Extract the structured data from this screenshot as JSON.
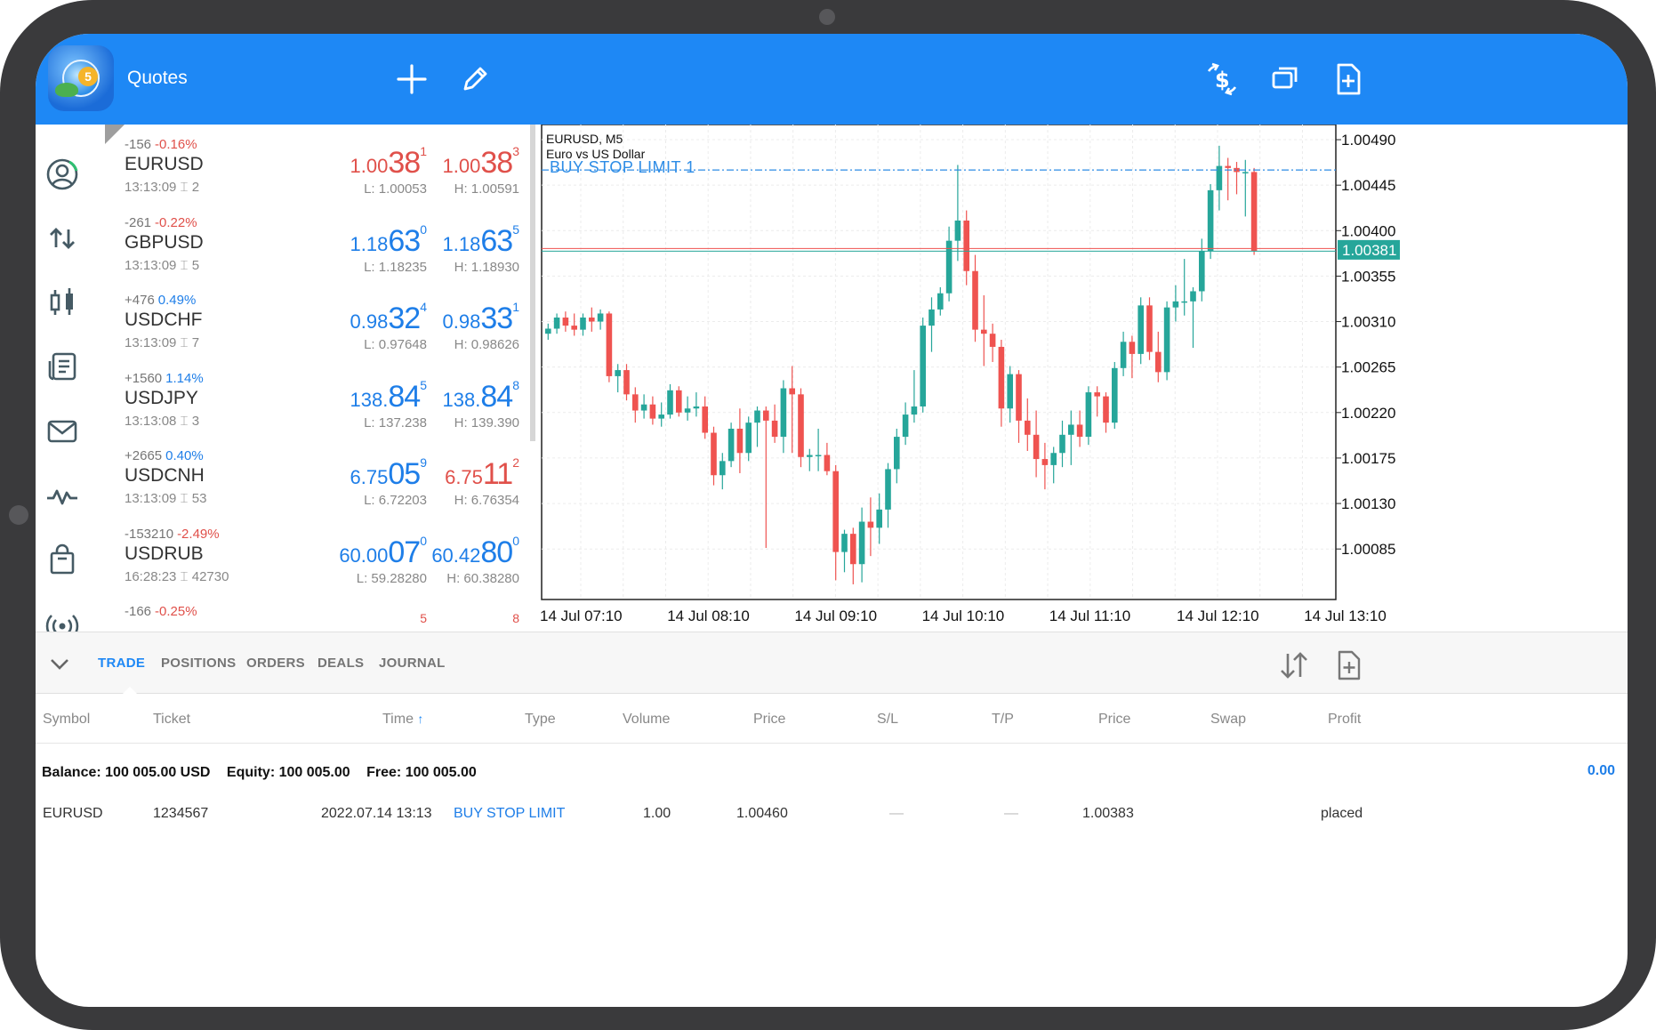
{
  "app": {
    "title": "Quotes",
    "icons": [
      "add-icon",
      "edit-icon",
      "currency-exchange-icon",
      "window-stack-icon",
      "new-document-icon"
    ]
  },
  "rail": {
    "icons": [
      "account-icon",
      "trade-arrows-icon",
      "candles-icon",
      "news-icon",
      "mail-icon",
      "signals-icon",
      "market-bag-icon",
      "broadcast-icon"
    ]
  },
  "quotes": [
    {
      "change": "-156",
      "pct": "-0.16%",
      "pct_color": "red",
      "symbol": "EURUSD",
      "time": "13:13:09",
      "spread": "2",
      "bid": {
        "color": "red",
        "pre": "1.00",
        "big": "38",
        "sup": "1"
      },
      "ask": {
        "color": "red",
        "pre": "1.00",
        "big": "38",
        "sup": "3"
      },
      "low": "L: 1.00053",
      "high": "H: 1.00591"
    },
    {
      "change": "-261",
      "pct": "-0.22%",
      "pct_color": "red",
      "symbol": "GBPUSD",
      "time": "13:13:09",
      "spread": "5",
      "bid": {
        "color": "blue",
        "pre": "1.18",
        "big": "63",
        "sup": "0"
      },
      "ask": {
        "color": "blue",
        "pre": "1.18",
        "big": "63",
        "sup": "5"
      },
      "low": "L: 1.18235",
      "high": "H: 1.18930"
    },
    {
      "change": "+476",
      "pct": "0.49%",
      "pct_color": "blue",
      "symbol": "USDCHF",
      "time": "13:13:09",
      "spread": "7",
      "bid": {
        "color": "blue",
        "pre": "0.98",
        "big": "32",
        "sup": "4"
      },
      "ask": {
        "color": "blue",
        "pre": "0.98",
        "big": "33",
        "sup": "1"
      },
      "low": "L: 0.97648",
      "high": "H: 0.98626"
    },
    {
      "change": "+1560",
      "pct": "1.14%",
      "pct_color": "blue",
      "symbol": "USDJPY",
      "time": "13:13:08",
      "spread": "3",
      "bid": {
        "color": "blue",
        "pre": "138.",
        "big": "84",
        "sup": "5"
      },
      "ask": {
        "color": "blue",
        "pre": "138.",
        "big": "84",
        "sup": "8"
      },
      "low": "L: 137.238",
      "high": "H: 139.390"
    },
    {
      "change": "+2665",
      "pct": "0.40%",
      "pct_color": "blue",
      "symbol": "USDCNH",
      "time": "13:13:09",
      "spread": "53",
      "bid": {
        "color": "blue",
        "pre": "6.75",
        "big": "05",
        "sup": "9"
      },
      "ask": {
        "color": "red",
        "pre": "6.75",
        "big": "11",
        "sup": "2"
      },
      "low": "L: 6.72203",
      "high": "H: 6.76354"
    },
    {
      "change": "-153210",
      "pct": "-2.49%",
      "pct_color": "red",
      "symbol": "USDRUB",
      "time": "16:28:23",
      "spread": "42730",
      "bid": {
        "color": "blue",
        "pre": "60.00",
        "big": "07",
        "sup": "0"
      },
      "ask": {
        "color": "blue",
        "pre": "60.42",
        "big": "80",
        "sup": "0"
      },
      "low": "L: 59.28280",
      "high": "H: 60.38280"
    },
    {
      "change": "-166",
      "pct": "-0.25%",
      "pct_color": "red",
      "symbol": "",
      "time": "",
      "spread": "",
      "bid": {
        "color": "red",
        "pre": "",
        "big": "",
        "sup": "5"
      },
      "ask": {
        "color": "red",
        "pre": "",
        "big": "",
        "sup": "8"
      },
      "low": "",
      "high": ""
    }
  ],
  "chart_data": {
    "type": "candlestick",
    "symbol_timeframe": "EURUSD, M5",
    "description": "Euro vs US Dollar",
    "order_label": "BUY STOP LIMIT 1",
    "order_level": 1.0046,
    "current_price": 1.00381,
    "current_price_label": "1.00381",
    "ylim": [
      1.00035,
      1.00505
    ],
    "y_ticks": [
      "1.00490",
      "1.00445",
      "1.00400",
      "1.00355",
      "1.00310",
      "1.00265",
      "1.00220",
      "1.00175",
      "1.00130",
      "1.00085"
    ],
    "y_tick_values": [
      1.0049,
      1.00445,
      1.004,
      1.00355,
      1.0031,
      1.00265,
      1.0022,
      1.00175,
      1.0013,
      1.00085
    ],
    "x_ticks": [
      "14 Jul 07:10",
      "14 Jul 08:10",
      "14 Jul 09:10",
      "14 Jul 10:10",
      "14 Jul 11:10",
      "14 Jul 12:10",
      "14 Jul 13:10"
    ],
    "grid": true,
    "up_color": "#26a69a",
    "down_color": "#ef5350",
    "candles": [
      [
        1.00298,
        1.00308,
        1.00292,
        1.00303
      ],
      [
        1.00303,
        1.00318,
        1.00298,
        1.00314
      ],
      [
        1.00314,
        1.0032,
        1.003,
        1.00306
      ],
      [
        1.00306,
        1.00318,
        1.00296,
        1.00302
      ],
      [
        1.00302,
        1.00318,
        1.00296,
        1.00314
      ],
      [
        1.00314,
        1.00324,
        1.003,
        1.0031
      ],
      [
        1.0031,
        1.00322,
        1.00302,
        1.00318
      ],
      [
        1.00318,
        1.0032,
        1.0025,
        1.00256
      ],
      [
        1.00256,
        1.00268,
        1.0024,
        1.00262
      ],
      [
        1.00262,
        1.00268,
        1.00232,
        1.00238
      ],
      [
        1.00238,
        1.00245,
        1.0021,
        1.00222
      ],
      [
        1.00222,
        1.00238,
        1.00214,
        1.00228
      ],
      [
        1.00228,
        1.00236,
        1.00208,
        1.00214
      ],
      [
        1.00214,
        1.0023,
        1.00206,
        1.00218
      ],
      [
        1.00218,
        1.00248,
        1.00214,
        1.00242
      ],
      [
        1.00242,
        1.00246,
        1.00216,
        1.0022
      ],
      [
        1.0022,
        1.00236,
        1.00212,
        1.00224
      ],
      [
        1.00224,
        1.0024,
        1.00216,
        1.00226
      ],
      [
        1.00226,
        1.00236,
        1.00194,
        1.002
      ],
      [
        1.002,
        1.00206,
        1.00148,
        1.00158
      ],
      [
        1.00158,
        1.0018,
        1.00144,
        1.00172
      ],
      [
        1.00172,
        1.0021,
        1.00166,
        1.00204
      ],
      [
        1.00204,
        1.00224,
        1.0016,
        1.0018
      ],
      [
        1.0018,
        1.00216,
        1.00172,
        1.0021
      ],
      [
        1.0021,
        1.00226,
        1.00186,
        1.00222
      ],
      [
        1.00222,
        1.00226,
        1.00086,
        1.00212
      ],
      [
        1.00212,
        1.00228,
        1.0019,
        1.00196
      ],
      [
        1.00196,
        1.00252,
        1.0018,
        1.00244
      ],
      [
        1.00244,
        1.00266,
        1.0018,
        1.00238
      ],
      [
        1.00238,
        1.00244,
        1.00166,
        1.00176
      ],
      [
        1.00176,
        1.00184,
        1.00162,
        1.00178
      ],
      [
        1.00178,
        1.00204,
        1.00162,
        1.00178
      ],
      [
        1.00178,
        1.0019,
        1.00158,
        1.00162
      ],
      [
        1.00162,
        1.00168,
        1.00054,
        1.00082
      ],
      [
        1.00082,
        1.00104,
        1.00062,
        1.001
      ],
      [
        1.001,
        1.00106,
        1.0005,
        1.0007
      ],
      [
        1.0007,
        1.00126,
        1.00052,
        1.00112
      ],
      [
        1.00112,
        1.00136,
        1.00078,
        1.00106
      ],
      [
        1.00106,
        1.0014,
        1.0009,
        1.00124
      ],
      [
        1.00124,
        1.0017,
        1.00106,
        1.00164
      ],
      [
        1.00164,
        1.00204,
        1.0015,
        1.00196
      ],
      [
        1.00196,
        1.0023,
        1.00188,
        1.00218
      ],
      [
        1.00218,
        1.00262,
        1.0021,
        1.00226
      ],
      [
        1.00226,
        1.00314,
        1.0022,
        1.00306
      ],
      [
        1.00306,
        1.00334,
        1.0028,
        1.00322
      ],
      [
        1.00322,
        1.00344,
        1.00316,
        1.00338
      ],
      [
        1.00338,
        1.00404,
        1.0033,
        1.0039
      ],
      [
        1.0039,
        1.00465,
        1.0037,
        1.0041
      ],
      [
        1.0041,
        1.0042,
        1.00346,
        1.0036
      ],
      [
        1.0036,
        1.00376,
        1.0029,
        1.00302
      ],
      [
        1.00302,
        1.00336,
        1.00266,
        1.00298
      ],
      [
        1.00298,
        1.00308,
        1.0027,
        1.00285
      ],
      [
        1.00285,
        1.00292,
        1.00206,
        1.00224
      ],
      [
        1.00224,
        1.00266,
        1.0021,
        1.00258
      ],
      [
        1.00258,
        1.00262,
        1.0019,
        1.00212
      ],
      [
        1.00212,
        1.00234,
        1.00182,
        1.00198
      ],
      [
        1.00198,
        1.00222,
        1.00156,
        1.00174
      ],
      [
        1.00174,
        1.0019,
        1.00144,
        1.00168
      ],
      [
        1.00168,
        1.00186,
        1.0015,
        1.0018
      ],
      [
        1.0018,
        1.00212,
        1.00166,
        1.00198
      ],
      [
        1.00198,
        1.00222,
        1.00168,
        1.00208
      ],
      [
        1.00208,
        1.00222,
        1.00186,
        1.00196
      ],
      [
        1.00196,
        1.00246,
        1.00188,
        1.0024
      ],
      [
        1.0024,
        1.00246,
        1.00216,
        1.00236
      ],
      [
        1.00236,
        1.0024,
        1.002,
        1.0021
      ],
      [
        1.0021,
        1.0027,
        1.00204,
        1.00264
      ],
      [
        1.00264,
        1.003,
        1.00256,
        1.0029
      ],
      [
        1.0029,
        1.00296,
        1.00254,
        1.00278
      ],
      [
        1.00278,
        1.00334,
        1.00268,
        1.00326
      ],
      [
        1.00326,
        1.00334,
        1.00272,
        1.0028
      ],
      [
        1.0028,
        1.003,
        1.0025,
        1.0026
      ],
      [
        1.0026,
        1.0033,
        1.00252,
        1.00324
      ],
      [
        1.00324,
        1.00346,
        1.0031,
        1.0033
      ],
      [
        1.0033,
        1.00372,
        1.00316,
        1.0033
      ],
      [
        1.0033,
        1.00344,
        1.00284,
        1.0034
      ],
      [
        1.0034,
        1.00392,
        1.0033,
        1.0038
      ],
      [
        1.0038,
        1.00446,
        1.00372,
        1.0044
      ],
      [
        1.0044,
        1.00484,
        1.0042,
        1.00464
      ],
      [
        1.00464,
        1.00472,
        1.0043,
        1.00462
      ],
      [
        1.00462,
        1.00468,
        1.00436,
        1.00458
      ],
      [
        1.00458,
        1.0047,
        1.00414,
        1.00458
      ],
      [
        1.00458,
        1.00462,
        1.00376,
        1.0038
      ]
    ]
  },
  "tabs": [
    {
      "label": "TRADE",
      "active": true
    },
    {
      "label": "POSITIONS",
      "active": false
    },
    {
      "label": "ORDERS",
      "active": false
    },
    {
      "label": "DEALS",
      "active": false
    },
    {
      "label": "JOURNAL",
      "active": false
    }
  ],
  "table": {
    "headers": [
      "Symbol",
      "Ticket",
      "Time",
      "Type",
      "Volume",
      "Price",
      "S/L",
      "T/P",
      "Price",
      "Swap",
      "Profit"
    ],
    "sort_column": "Time",
    "balance": {
      "balance_label": "Balance:",
      "balance_value": "100 005.00 USD",
      "equity_label": "Equity:",
      "equity_value": "100 005.00",
      "free_label": "Free:",
      "free_value": "100 005.00",
      "profit": "0.00"
    },
    "rows": [
      {
        "symbol": "EURUSD",
        "ticket": "1234567",
        "time": "2022.07.14 13:13",
        "type": "BUY STOP LIMIT",
        "volume": "1.00",
        "price": "1.00460",
        "sl": "—",
        "tp": "—",
        "current_price": "1.00383",
        "swap": "",
        "profit": "placed"
      }
    ]
  }
}
